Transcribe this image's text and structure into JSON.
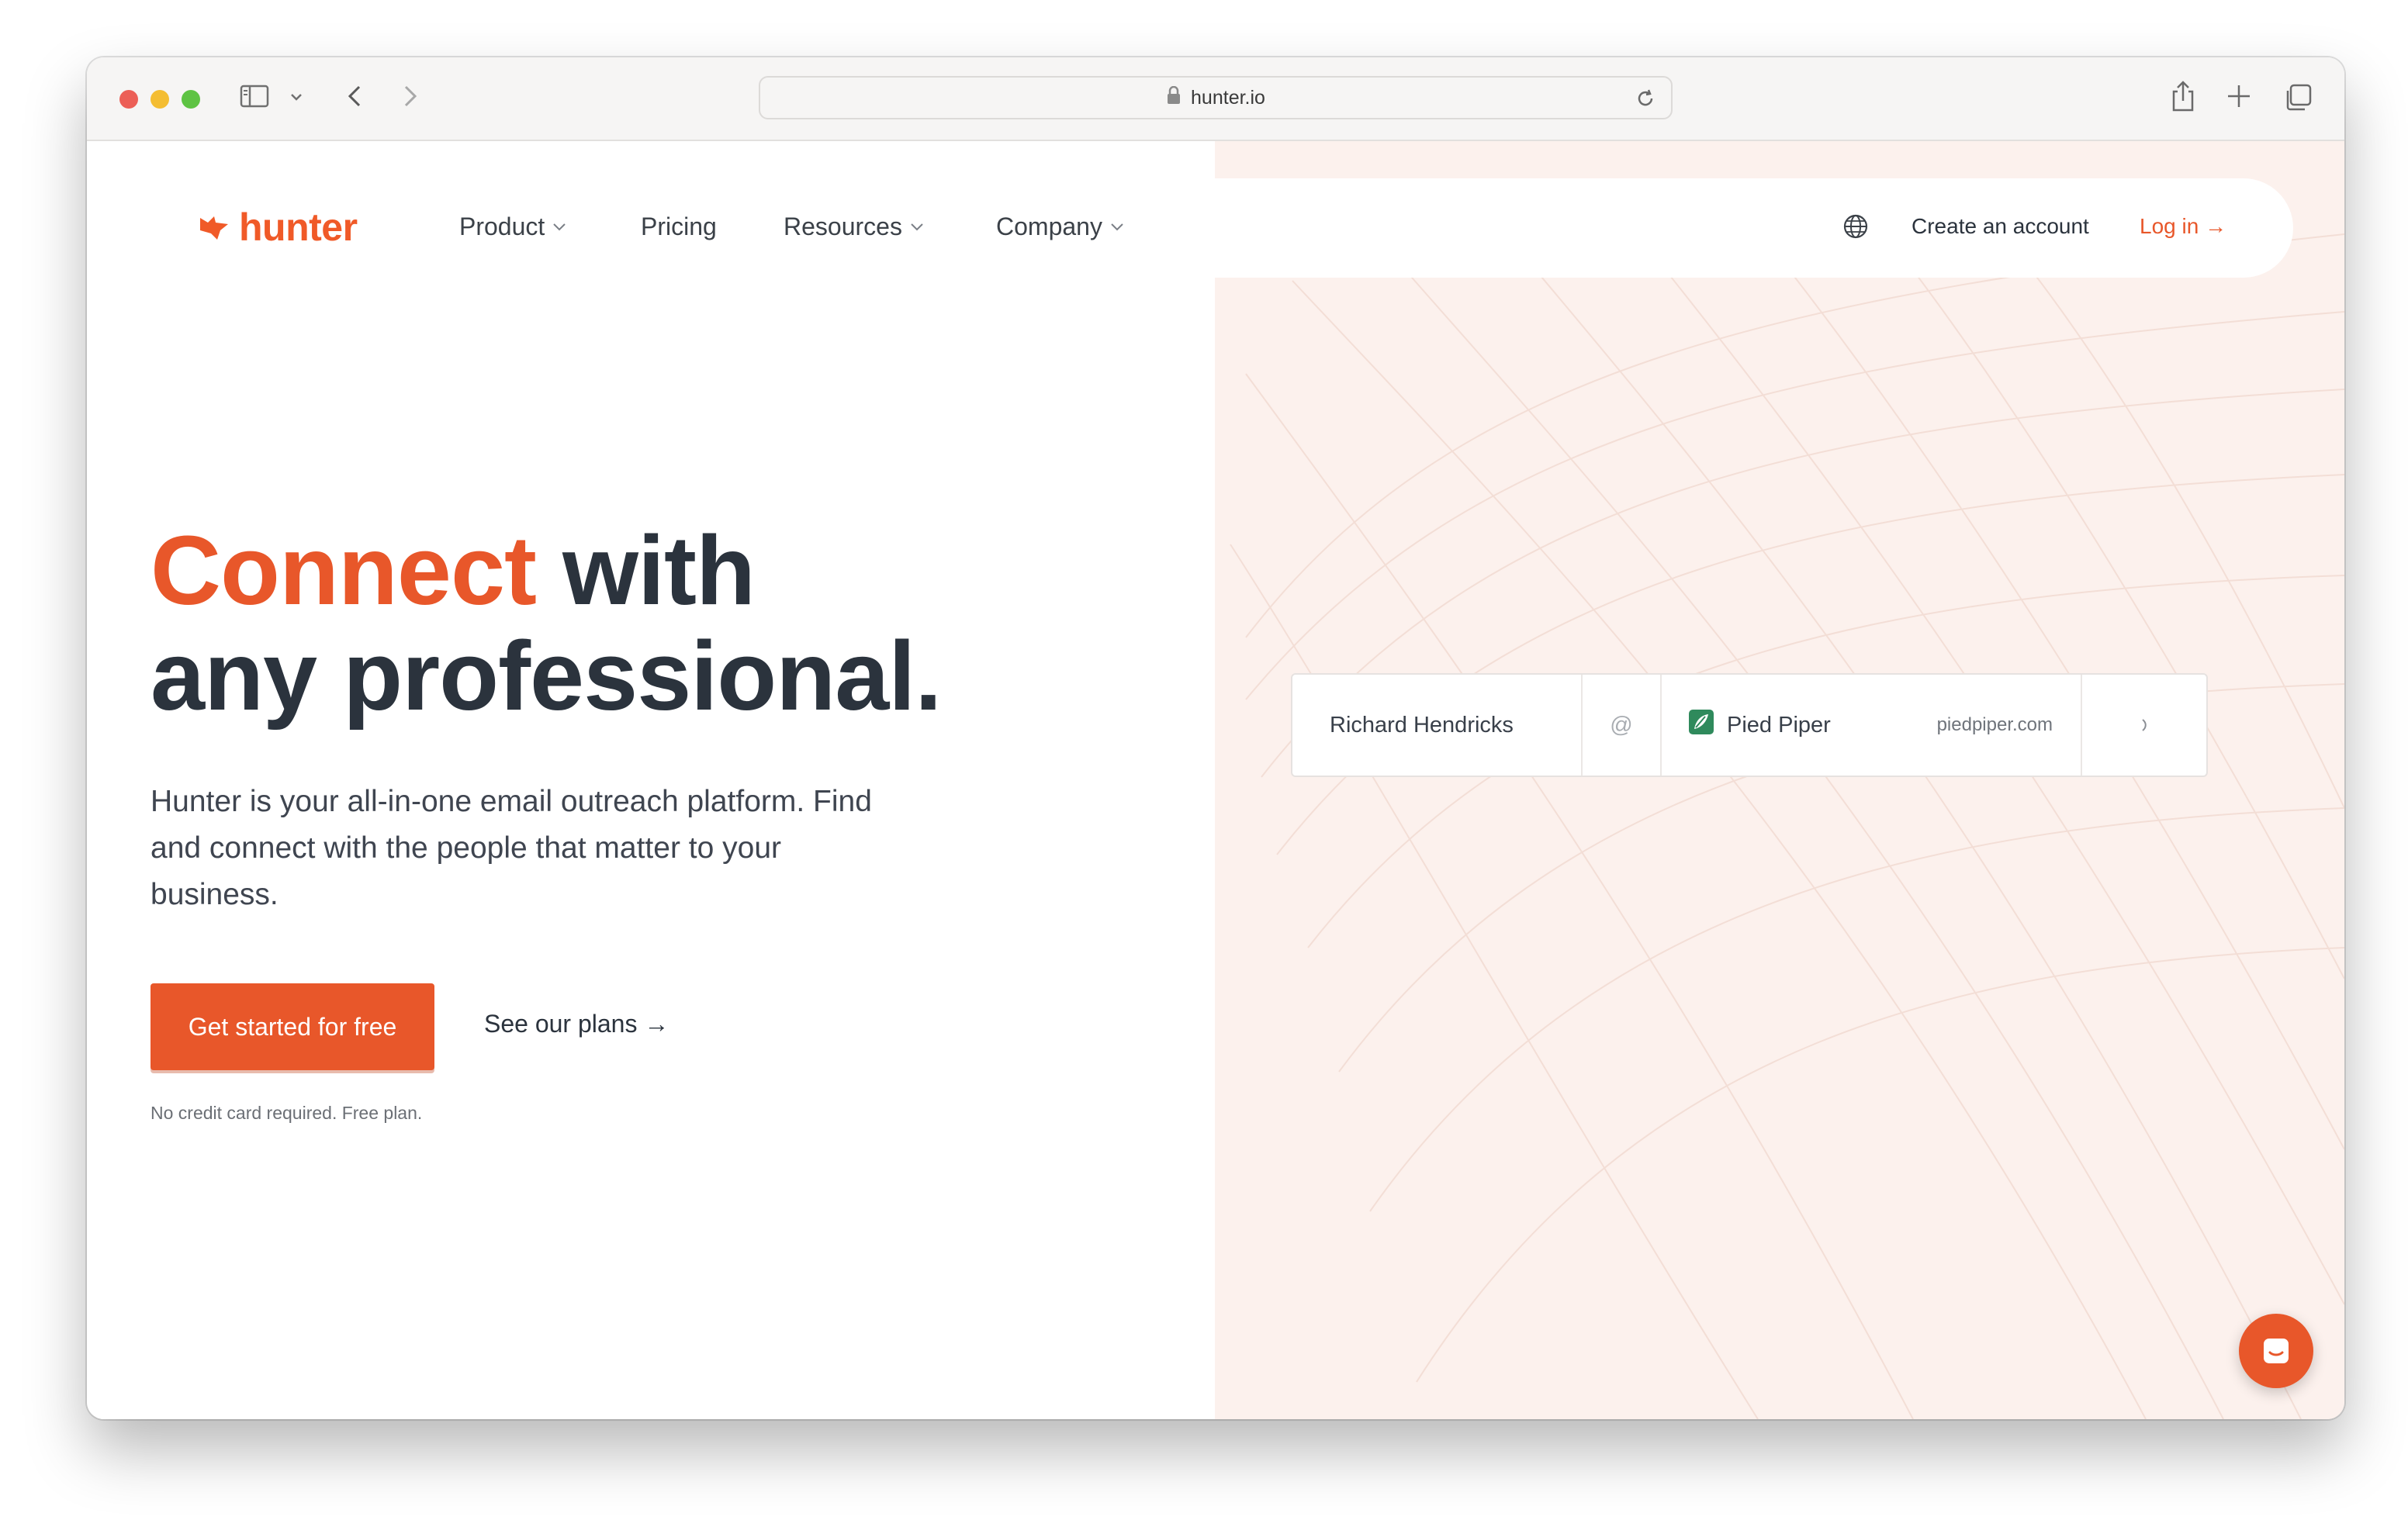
{
  "browser": {
    "url": "hunter.io"
  },
  "nav": {
    "logo_text": "hunter",
    "items": [
      {
        "label": "Product",
        "has_dropdown": true
      },
      {
        "label": "Pricing",
        "has_dropdown": false
      },
      {
        "label": "Resources",
        "has_dropdown": true
      },
      {
        "label": "Company",
        "has_dropdown": true
      }
    ],
    "create_account": "Create an account",
    "login": "Log in →"
  },
  "hero": {
    "title_accent": "Connect",
    "title_rest_1": " with",
    "title_line2": "any professional.",
    "description": "Hunter is your all-in-one email outreach platform. Find and connect with the people that matter to your business.",
    "cta_primary": "Get started for free",
    "cta_secondary": "See our plans →",
    "note": "No credit card required. Free plan."
  },
  "search_widget": {
    "name": "Richard Hendricks",
    "at": "@",
    "company": "Pied Piper",
    "domain": "piedpiper.com"
  },
  "colors": {
    "brand": "#e8572a",
    "text_dark": "#2b333d",
    "panel_bg": "#fcf1ed"
  }
}
